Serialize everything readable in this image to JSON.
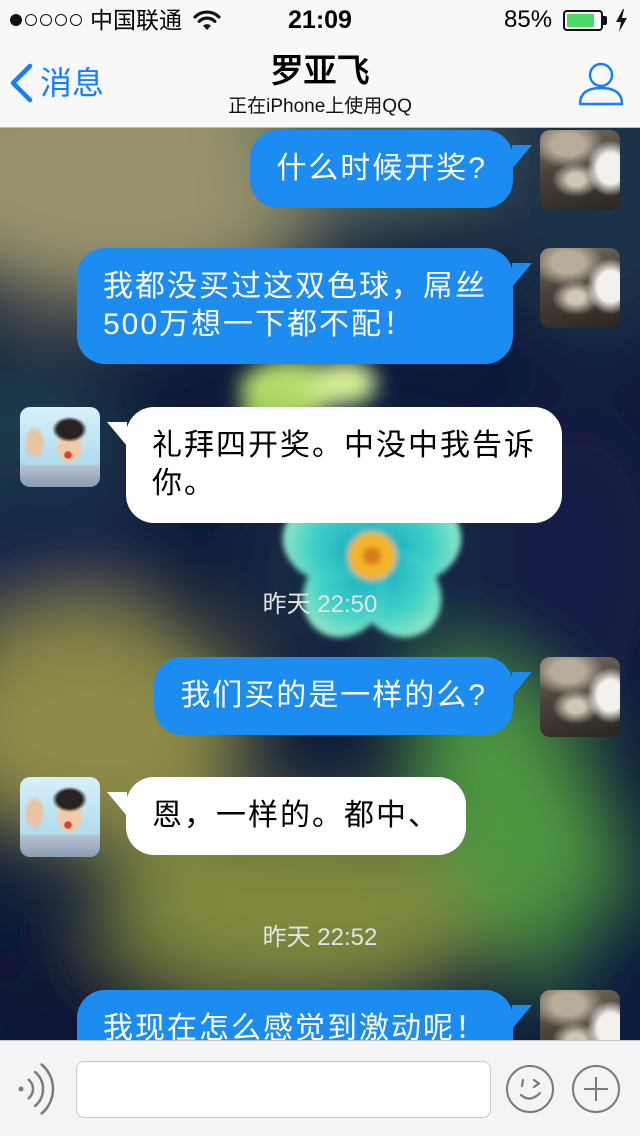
{
  "status_bar": {
    "signal_bars": 1,
    "carrier": "中国联通",
    "time": "21:09",
    "battery": "85%",
    "battery_level": 0.85
  },
  "nav": {
    "back_label": "消息",
    "title": "罗亚飞",
    "subtitle": "正在iPhone上使用QQ"
  },
  "conversation": [
    {
      "outgoing": true,
      "lines": [
        "什么时候开奖?"
      ]
    },
    {
      "outgoing": true,
      "lines": [
        "我都没买过这双色球，屌丝",
        "500万想一下都不配！"
      ]
    },
    {
      "outgoing": false,
      "lines": [
        "礼拜四开奖。中没中我告诉",
        "你。"
      ]
    },
    {
      "timestamp": "昨天 22:50"
    },
    {
      "outgoing": true,
      "lines": [
        "我们买的是一样的么?"
      ]
    },
    {
      "outgoing": false,
      "lines": [
        "恩，一样的。都中、"
      ]
    },
    {
      "timestamp": "昨天 22:52"
    },
    {
      "outgoing": true,
      "lines": [
        "我现在怎么感觉到激动呢！"
      ]
    }
  ],
  "colors": {
    "accent": "#157efb",
    "outgoing_bubble": "#1d8cf0",
    "incoming_bubble": "#ffffff",
    "battery_fill": "#4cd964",
    "timestamp": "#e4e4e4"
  },
  "icons": {
    "back": "chevron-left-icon",
    "profile": "person-icon",
    "wifi": "wifi-icon",
    "charging": "charging-icon",
    "voice": "voice-icon",
    "emoji": "smiley-icon",
    "more": "plus-icon"
  }
}
